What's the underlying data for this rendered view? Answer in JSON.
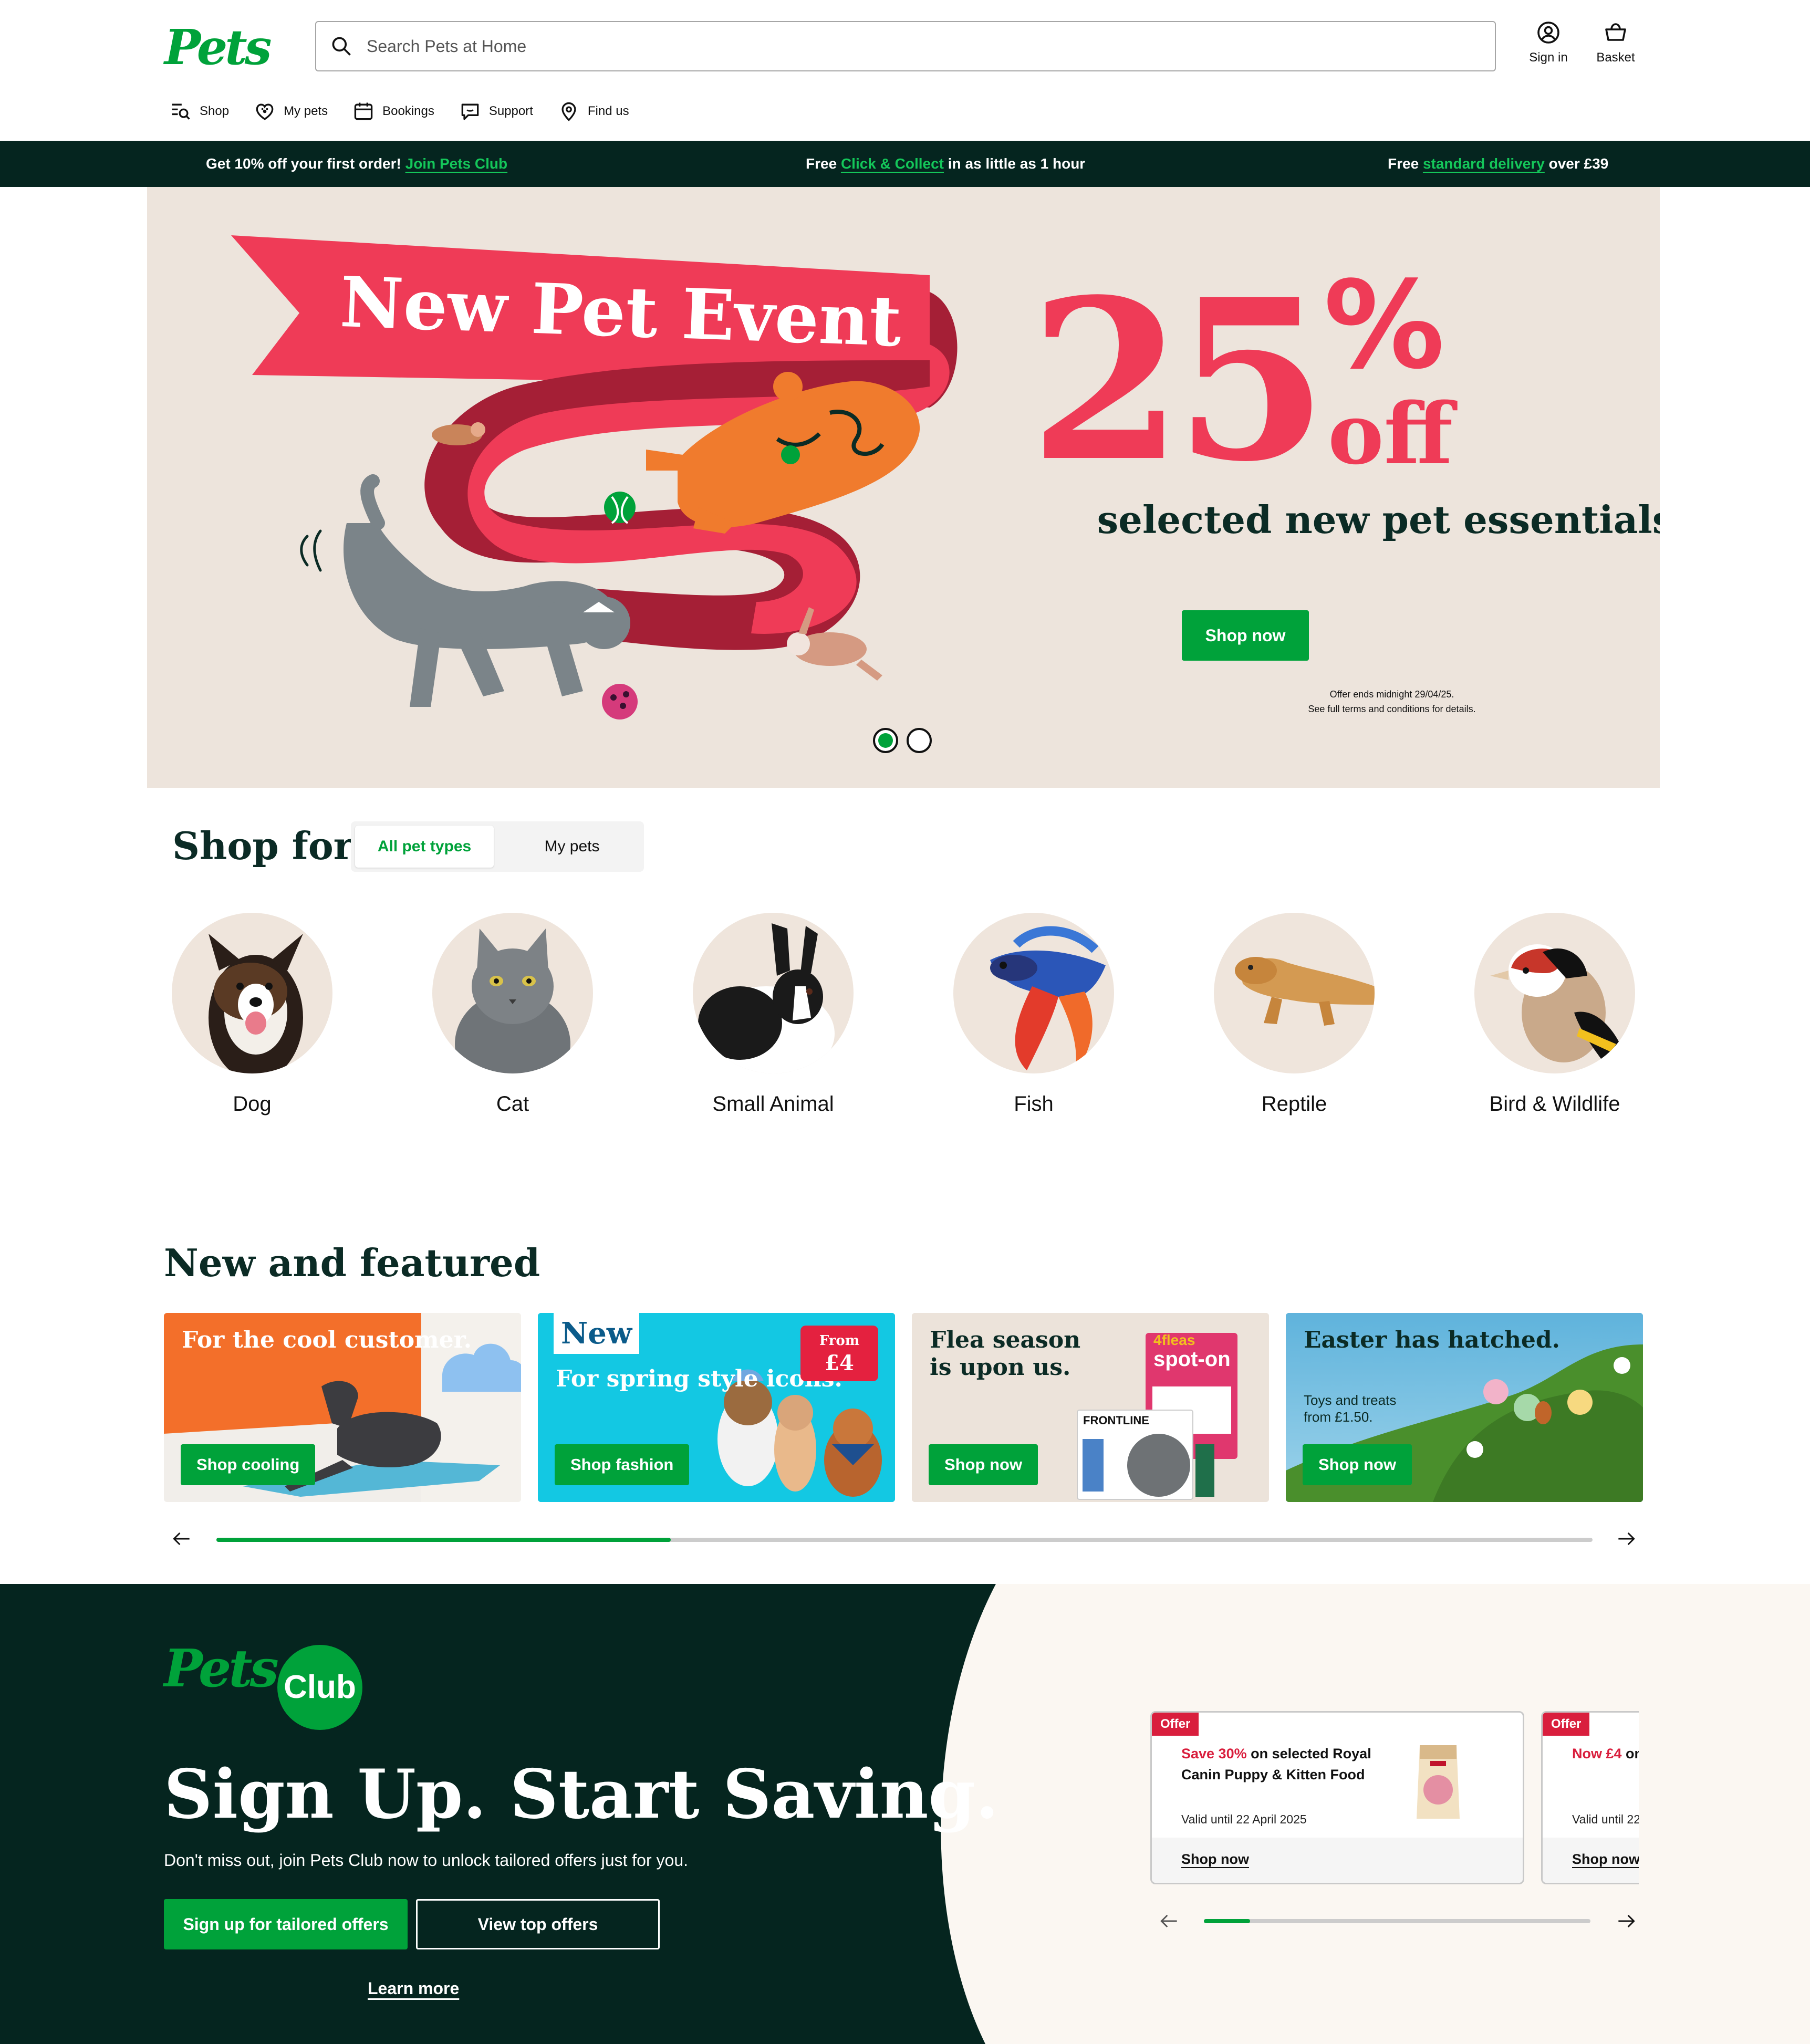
{
  "header": {
    "logo": "Pets",
    "search_placeholder": "Search Pets at Home",
    "sign_in": "Sign in",
    "basket": "Basket"
  },
  "nav": {
    "items": [
      {
        "label": "Shop",
        "icon": "shop-search-icon"
      },
      {
        "label": "My pets",
        "icon": "heart-paw-icon"
      },
      {
        "label": "Bookings",
        "icon": "calendar-icon"
      },
      {
        "label": "Support",
        "icon": "chat-icon"
      },
      {
        "label": "Find us",
        "icon": "location-pin-icon"
      }
    ]
  },
  "promo_bar": {
    "item1_pre": "Get 10% off your first order!",
    "item1_link": "Join Pets Club",
    "item2_pre": "Free",
    "item2_link": "Click & Collect",
    "item2_post": "in as little as 1 hour",
    "item3_pre": "Free",
    "item3_link": "standard delivery",
    "item3_post": "over £39"
  },
  "hero": {
    "banner": "New Pet Event",
    "big": "25",
    "percent": "%",
    "off": "off",
    "subtitle": "selected new pet essentials.",
    "cta": "Shop now",
    "terms_line1": "Offer ends midnight 29/04/25.",
    "terms_line2": "See full terms and conditions for details.",
    "slides_total": 2,
    "active_slide": 1
  },
  "shop_for": {
    "title": "Shop for",
    "tabs": [
      "All pet types",
      "My pets"
    ],
    "active_tab": "All pet types",
    "pets": [
      "Dog",
      "Cat",
      "Small Animal",
      "Fish",
      "Reptile",
      "Bird & Wildlife"
    ]
  },
  "featured": {
    "title": "New and featured",
    "cards": [
      {
        "title": "For the cool customer.",
        "cta": "Shop cooling"
      },
      {
        "badge": "New",
        "title": "For spring style icons.",
        "price_from": "From",
        "price": "£4",
        "cta": "Shop fashion"
      },
      {
        "title": "Flea season is upon us.",
        "cta": "Shop now",
        "product1": "spot-on",
        "product1_top": "4fleas",
        "product2": "FRONTLINE"
      },
      {
        "title": "Easter has hatched.",
        "subtitle": "Toys and treats from £1.50.",
        "cta": "Shop now"
      }
    ],
    "scroll_progress": 0.33
  },
  "club": {
    "logo_pets": "Pets",
    "logo_club": "Club",
    "title": "Sign Up. Start Saving.",
    "subtitle": "Don't miss out, join Pets Club now to unlock tailored offers just for you.",
    "btn_primary": "Sign up for tailored offers",
    "btn_secondary": "View top offers",
    "learn_more": "Learn more",
    "offers": [
      {
        "tag": "Offer",
        "highlight": "Save 30%",
        "text": "on selected Royal Canin Puppy & Kitten Food",
        "valid": "Valid until 22 April 2025",
        "cta": "Shop now"
      },
      {
        "tag": "Offer",
        "highlight": "Now £4",
        "text": "on Cat food",
        "valid": "Valid until 22",
        "cta": "Shop now"
      }
    ],
    "scroll_progress": 0.12
  },
  "colors": {
    "brand_green": "#00a23a",
    "dark_green": "#05251f",
    "hero_pink": "#ef3b57",
    "hero_bg": "#ede4dc",
    "offer_red": "#d91e3d"
  }
}
